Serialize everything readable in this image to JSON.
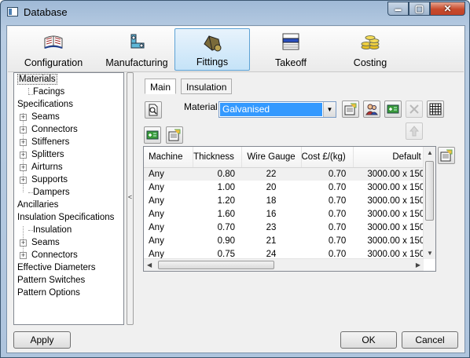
{
  "window": {
    "title": "Database",
    "minimize_glyph": "▬",
    "maximize_glyph": "▢",
    "close_glyph": "✕"
  },
  "ribbon": {
    "tabs": [
      {
        "label": "Configuration",
        "icon": "configuration-icon"
      },
      {
        "label": "Manufacturing",
        "icon": "manufacturing-icon"
      },
      {
        "label": "Fittings",
        "icon": "fittings-icon",
        "active": true
      },
      {
        "label": "Takeoff",
        "icon": "takeoff-icon"
      },
      {
        "label": "Costing",
        "icon": "costing-icon"
      }
    ]
  },
  "tree": {
    "nodes": [
      {
        "label": "Materials",
        "level": 0,
        "selected": true
      },
      {
        "label": "Facings",
        "level": 1
      },
      {
        "label": "Specifications",
        "level": 0
      },
      {
        "label": "Seams",
        "level": 1,
        "expandable": true
      },
      {
        "label": "Connectors",
        "level": 1,
        "expandable": true
      },
      {
        "label": "Stiffeners",
        "level": 1,
        "expandable": true
      },
      {
        "label": "Splitters",
        "level": 1,
        "expandable": true
      },
      {
        "label": "Airturns",
        "level": 1,
        "expandable": true
      },
      {
        "label": "Supports",
        "level": 1,
        "expandable": true
      },
      {
        "label": "Dampers",
        "level": 1
      },
      {
        "label": "Ancillaries",
        "level": 0
      },
      {
        "label": "Insulation Specifications",
        "level": 0
      },
      {
        "label": "Insulation",
        "level": 1
      },
      {
        "label": "Seams",
        "level": 1,
        "expandable": true
      },
      {
        "label": "Connectors",
        "level": 1,
        "expandable": true
      },
      {
        "label": "Effective Diameters",
        "level": 0
      },
      {
        "label": "Pattern Switches",
        "level": 0
      },
      {
        "label": "Pattern Options",
        "level": 0
      }
    ]
  },
  "splitter_glyph": "<",
  "panel": {
    "tabs": [
      "Main",
      "Insulation"
    ],
    "active_tab": "Main",
    "material_label": "Material",
    "material_value": "Galvanised",
    "combo_arrow": "▼"
  },
  "grid": {
    "columns": [
      "Machine",
      "Thickness",
      "Wire Gauge",
      "Cost £/(kg)",
      "Default"
    ],
    "rows": [
      [
        "Any",
        "0.80",
        "22",
        "0.70",
        "3000.00 x 150"
      ],
      [
        "Any",
        "1.00",
        "20",
        "0.70",
        "3000.00 x 150"
      ],
      [
        "Any",
        "1.20",
        "18",
        "0.70",
        "3000.00 x 150"
      ],
      [
        "Any",
        "1.60",
        "16",
        "0.70",
        "3000.00 x 150"
      ],
      [
        "Any",
        "0.70",
        "23",
        "0.70",
        "3000.00 x 150"
      ],
      [
        "Any",
        "0.90",
        "21",
        "0.70",
        "3000.00 x 150"
      ],
      [
        "Any",
        "0.75",
        "24",
        "0.70",
        "3000.00 x 150"
      ]
    ],
    "selected_row": 0
  },
  "buttons": {
    "apply": "Apply",
    "ok": "OK",
    "cancel": "Cancel"
  },
  "colors": {
    "selection": "#3399ff",
    "active_tab_border": "#5da2d5"
  }
}
